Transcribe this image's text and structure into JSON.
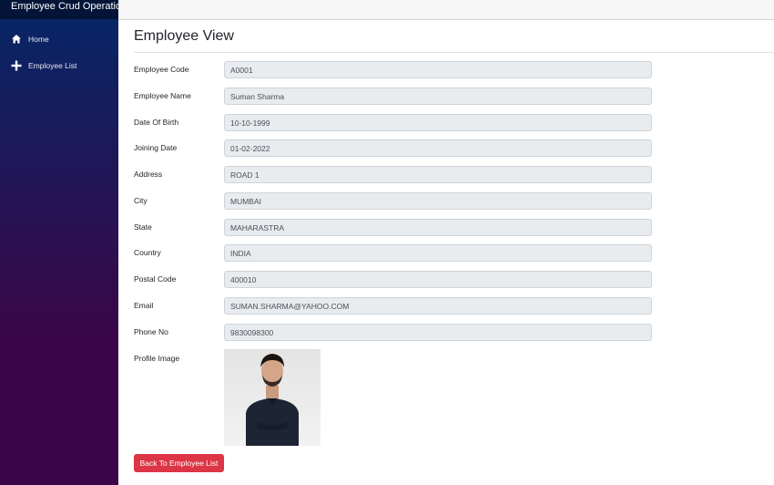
{
  "app": {
    "title": "Employee Crud Operations"
  },
  "sidebar": {
    "items": [
      {
        "label": "Home",
        "icon": "home-icon"
      },
      {
        "label": "Employee List",
        "icon": "plus-icon"
      }
    ]
  },
  "page": {
    "title": "Employee View"
  },
  "fields": {
    "code": {
      "label": "Employee Code",
      "value": "A0001"
    },
    "name": {
      "label": "Employee Name",
      "value": "Suman Sharma"
    },
    "dob": {
      "label": "Date Of Birth",
      "value": "10-10-1999"
    },
    "joining": {
      "label": "Joining Date",
      "value": "01-02-2022"
    },
    "address": {
      "label": "Address",
      "value": "ROAD 1"
    },
    "city": {
      "label": "City",
      "value": "MUMBAI"
    },
    "state": {
      "label": "State",
      "value": "MAHARASTRA"
    },
    "country": {
      "label": "Country",
      "value": "INDIA"
    },
    "postal": {
      "label": "Postal Code",
      "value": "400010"
    },
    "email": {
      "label": "Email",
      "value": "SUMAN.SHARMA@YAHOO.COM"
    },
    "phone": {
      "label": "Phone No",
      "value": "9830098300"
    }
  },
  "profile": {
    "label": "Profile Image"
  },
  "actions": {
    "back_label": "Back To Employee List"
  },
  "colors": {
    "danger": "#dc3545",
    "sidebar_top": "#052767",
    "sidebar_bottom": "#3a0647"
  }
}
